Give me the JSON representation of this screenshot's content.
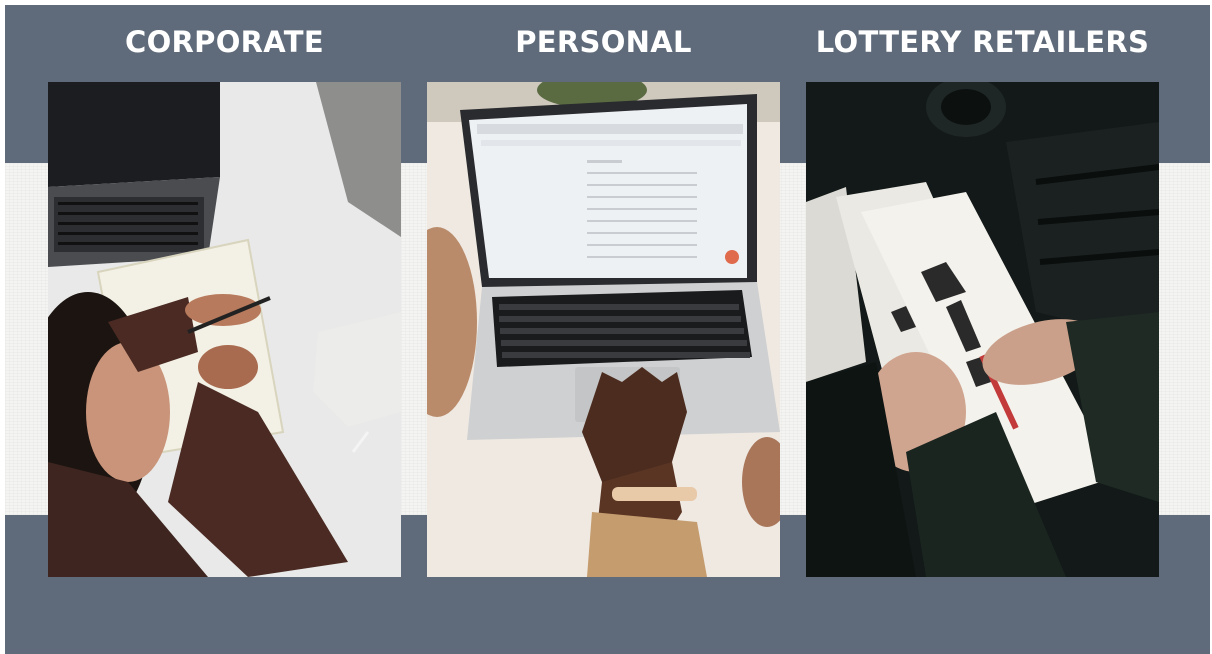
{
  "categories": {
    "corporate": {
      "label": "CORPORATE"
    },
    "personal": {
      "label": "PERSONAL"
    },
    "lottery": {
      "label": "LOTTERY RETAILERS"
    }
  },
  "colors": {
    "band": "#5f6b7a",
    "heading_text": "#ffffff",
    "background": "#f4f4f3"
  }
}
